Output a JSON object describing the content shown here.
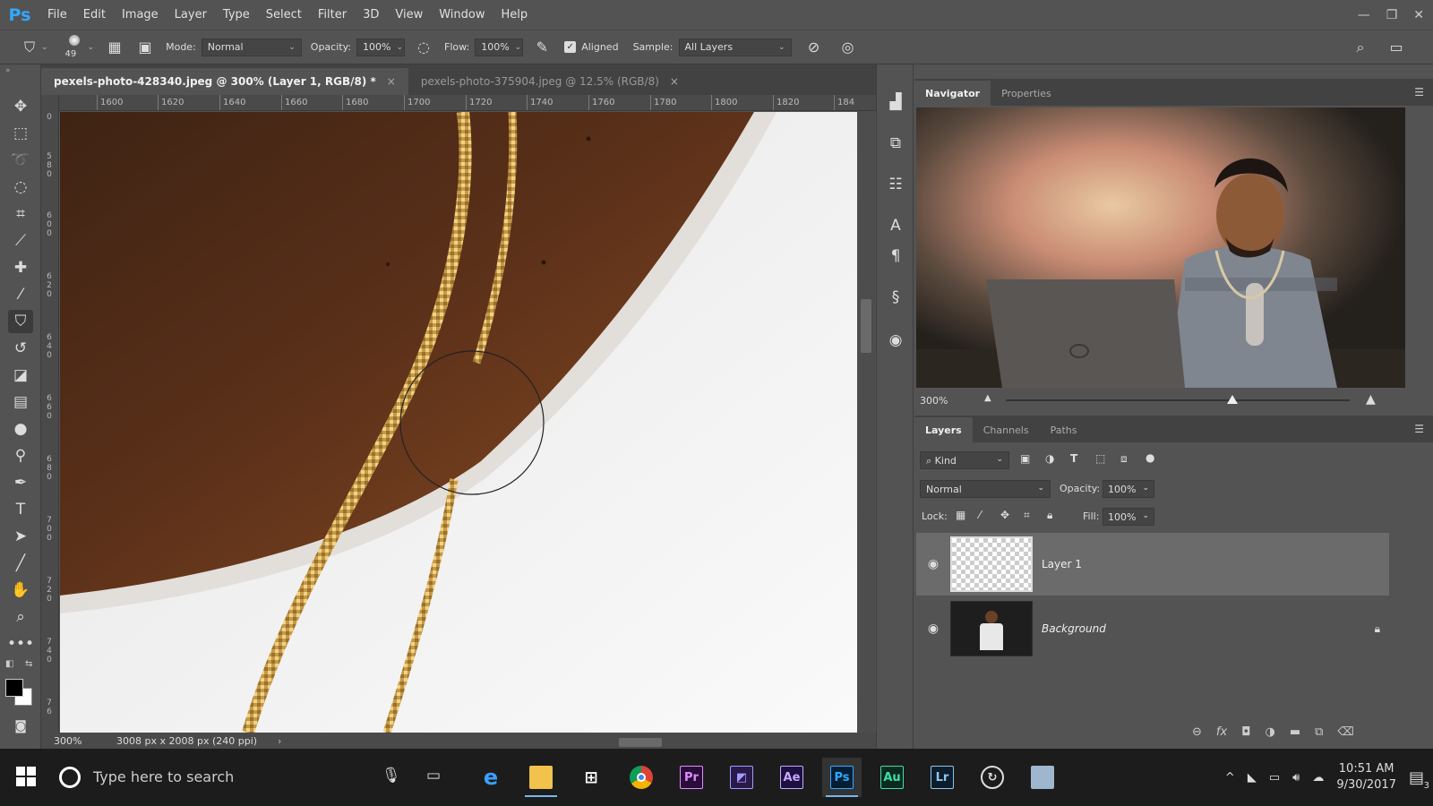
{
  "app": {
    "logo": "Ps",
    "menu": [
      "File",
      "Edit",
      "Image",
      "Layer",
      "Type",
      "Select",
      "Filter",
      "3D",
      "View",
      "Window",
      "Help"
    ],
    "window_controls": [
      "—",
      "❐",
      "✕"
    ]
  },
  "options": {
    "brush_size": "49",
    "mode_label": "Mode:",
    "mode_value": "Normal",
    "opacity_label": "Opacity:",
    "opacity_value": "100%",
    "flow_label": "Flow:",
    "flow_value": "100%",
    "aligned_label": "Aligned",
    "aligned_checked": true,
    "sample_label": "Sample:",
    "sample_value": "All Layers"
  },
  "tabs": [
    {
      "label": "pexels-photo-428340.jpeg @ 300% (Layer 1, RGB/8) *",
      "close": "×",
      "active": true
    },
    {
      "label": "pexels-photo-375904.jpeg @ 12.5% (RGB/8)",
      "close": "×",
      "active": false
    }
  ],
  "ruler_top": [
    "1600",
    "1620",
    "1640",
    "1660",
    "1680",
    "1700",
    "1720",
    "1740",
    "1760",
    "1780",
    "1800",
    "1820",
    "184"
  ],
  "ruler_left": [
    "0",
    "580",
    "600",
    "620",
    "640",
    "660",
    "680",
    "700",
    "720",
    "740",
    "76"
  ],
  "status": {
    "zoom": "300%",
    "doc_size": "3008 px x 2008 px (240 ppi)",
    "arrow": "›"
  },
  "navigator": {
    "tab_navigator": "Navigator",
    "tab_properties": "Properties",
    "zoom": "300%",
    "zoom_slider_fraction": 0.66
  },
  "layers_panel": {
    "tab_layers": "Layers",
    "tab_channels": "Channels",
    "tab_paths": "Paths",
    "kind_label": "Kind",
    "blend_mode": "Normal",
    "opacity_label": "Opacity:",
    "opacity_value": "100%",
    "lock_label": "Lock:",
    "fill_label": "Fill:",
    "fill_value": "100%",
    "layers": [
      {
        "name": "Layer 1",
        "selected": true
      },
      {
        "name": "Background",
        "selected": false,
        "locked": true
      }
    ]
  },
  "taskbar": {
    "search_placeholder": "Type here to search",
    "time": "10:51 AM",
    "date": "9/30/2017",
    "notifications": "3",
    "apps": [
      "edge",
      "file-explorer",
      "store",
      "chrome",
      "Pr",
      "premiere-preview",
      "Ae",
      "Ps",
      "Au",
      "Lr",
      "sync",
      "app"
    ]
  },
  "colors": {
    "ui_bg": "#535353",
    "panel_dark": "#424242",
    "ps_blue": "#31a8ff",
    "skin": "#6e3a1c",
    "shirt": "#f2f2f2",
    "chain": "#d8b060"
  }
}
